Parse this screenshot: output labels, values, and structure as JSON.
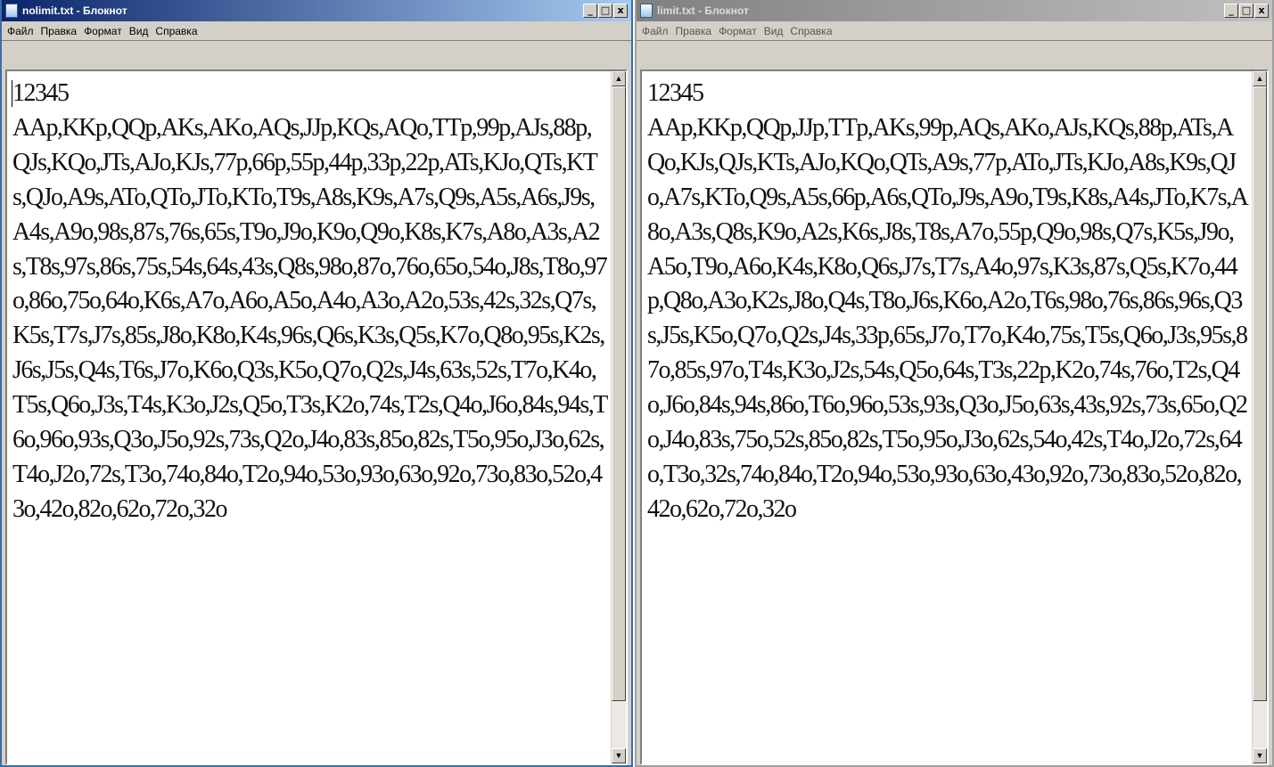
{
  "windows": [
    {
      "title": "nolimit.txt - Блокнот",
      "menu": [
        "Файл",
        "Правка",
        "Формат",
        "Вид",
        "Справка"
      ],
      "content": "12345\nAAp,KKp,QQp,AKs,AKo,AQs,JJp,KQs,AQo,TTp,99p,AJs,88p,QJs,KQo,JTs,AJo,KJs,77p,66p,55p,44p,33p,22p,ATs,KJo,QTs,KTs,QJo,A9s,ATo,QTo,JTo,KTo,T9s,A8s,K9s,A7s,Q9s,A5s,A6s,J9s,A4s,A9o,98s,87s,76s,65s,T9o,J9o,K9o,Q9o,K8s,K7s,A8o,A3s,A2s,T8s,97s,86s,75s,54s,64s,43s,Q8s,98o,87o,76o,65o,54o,J8s,T8o,97o,86o,75o,64o,K6s,A7o,A6o,A5o,A4o,A3o,A2o,53s,42s,32s,Q7s,K5s,T7s,J7s,85s,J8o,K8o,K4s,96s,Q6s,K3s,Q5s,K7o,Q8o,95s,K2s,J6s,J5s,Q4s,T6s,J7o,K6o,Q3s,K5o,Q7o,Q2s,J4s,63s,52s,T7o,K4o,T5s,Q6o,J3s,T4s,K3o,J2s,Q5o,T3s,K2o,74s,T2s,Q4o,J6o,84s,94s,T6o,96o,93s,Q3o,J5o,92s,73s,Q2o,J4o,83s,85o,82s,T5o,95o,J3o,62s,T4o,J2o,72s,T3o,74o,84o,T2o,94o,53o,93o,63o,92o,73o,83o,52o,43o,42o,82o,62o,72o,32o"
    },
    {
      "title": "limit.txt - Блокнот",
      "menu": [
        "Файл",
        "Правка",
        "Формат",
        "Вид",
        "Справка"
      ],
      "content": "12345\nAAp,KKp,QQp,JJp,TTp,AKs,99p,AQs,AKo,AJs,KQs,88p,ATs,AQo,KJs,QJs,KTs,AJo,KQo,QTs,A9s,77p,ATo,JTs,KJo,A8s,K9s,QJo,A7s,KTo,Q9s,A5s,66p,A6s,QTo,J9s,A9o,T9s,K8s,A4s,JTo,K7s,A8o,A3s,Q8s,K9o,A2s,K6s,J8s,T8s,A7o,55p,Q9o,98s,Q7s,K5s,J9o,A5o,T9o,A6o,K4s,K8o,Q6s,J7s,T7s,A4o,97s,K3s,87s,Q5s,K7o,44p,Q8o,A3o,K2s,J8o,Q4s,T8o,J6s,K6o,A2o,T6s,98o,76s,86s,96s,Q3s,J5s,K5o,Q7o,Q2s,J4s,33p,65s,J7o,T7o,K4o,75s,T5s,Q6o,J3s,95s,87o,85s,97o,T4s,K3o,J2s,54s,Q5o,64s,T3s,22p,K2o,74s,76o,T2s,Q4o,J6o,84s,94s,86o,T6o,96o,53s,93s,Q3o,J5o,63s,43s,92s,73s,65o,Q2o,J4o,83s,75o,52s,85o,82s,T5o,95o,J3o,62s,54o,42s,T4o,J2o,72s,64o,T3o,32s,74o,84o,T2o,94o,53o,93o,63o,43o,92o,73o,83o,52o,82o,42o,62o,72o,32o"
    }
  ],
  "controls": {
    "minimize": "_",
    "maximize": "□",
    "close": "x",
    "scroll_up": "▲",
    "scroll_down": "▼"
  },
  "colors": {
    "active_title": "#0a246a",
    "inactive_title": "#808080",
    "face": "#d4d0c8"
  }
}
